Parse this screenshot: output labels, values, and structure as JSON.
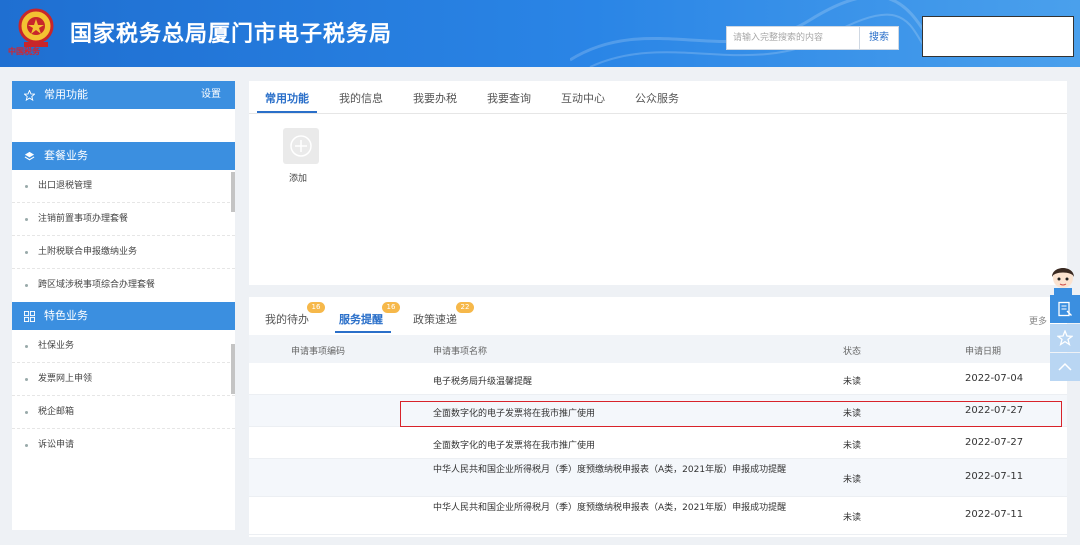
{
  "header": {
    "logo_text": "中国税务",
    "title": "国家税务总局厦门市电子税务局",
    "search_placeholder": "请输入完整搜索的内容",
    "search_button": "搜索"
  },
  "sidebar": {
    "common": {
      "title": "常用功能",
      "setting": "设置"
    },
    "package": {
      "title": "套餐业务",
      "items": [
        "出口退税管理",
        "注销前置事项办理套餐",
        "土附税联合申报缴纳业务",
        "跨区域涉税事项综合办理套餐"
      ]
    },
    "feature": {
      "title": "特色业务",
      "items": [
        "社保业务",
        "发票网上申领",
        "税企邮箱",
        "诉讼申请"
      ]
    }
  },
  "top_tabs": [
    "常用功能",
    "我的信息",
    "我要办税",
    "我要查询",
    "互动中心",
    "公众服务"
  ],
  "quick": {
    "add_label": "添加"
  },
  "bottom_tabs": [
    {
      "label": "我的待办",
      "badge": "16"
    },
    {
      "label": "服务提醒",
      "badge": "16"
    },
    {
      "label": "政策速递",
      "badge": "22"
    }
  ],
  "more": "更多",
  "table": {
    "columns": [
      "申请事项编码",
      "申请事项名称",
      "状态",
      "申请日期"
    ],
    "rows": [
      {
        "code": "",
        "name": "电子税务局升级温馨提醒",
        "status": "未读",
        "date": "2022-07-04"
      },
      {
        "code": "",
        "name": "全面数字化的电子发票将在我市推广使用",
        "status": "未读",
        "date": "2022-07-27"
      },
      {
        "code": "",
        "name": "全面数字化的电子发票将在我市推广使用",
        "status": "未读",
        "date": "2022-07-27"
      },
      {
        "code": "",
        "name": "中华人民共和国企业所得税月（季）度预缴纳税申报表（A类，2021年版）申报成功提醒",
        "status": "未读",
        "date": "2022-07-11"
      },
      {
        "code": "",
        "name": "中华人民共和国企业所得税月（季）度预缴纳税申报表（A类，2021年版）申报成功提醒",
        "status": "未读",
        "date": "2022-07-11"
      }
    ]
  },
  "colors": {
    "header": "#2a85e6",
    "accent": "#3b8fe0",
    "badge": "#f6b84a",
    "highlight": "#d8232a"
  },
  "icons": [
    "star-icon",
    "layers-icon",
    "grid-icon",
    "plus-icon",
    "document-icon",
    "chevron-up-icon",
    "emblem-icon",
    "avatar-icon"
  ]
}
